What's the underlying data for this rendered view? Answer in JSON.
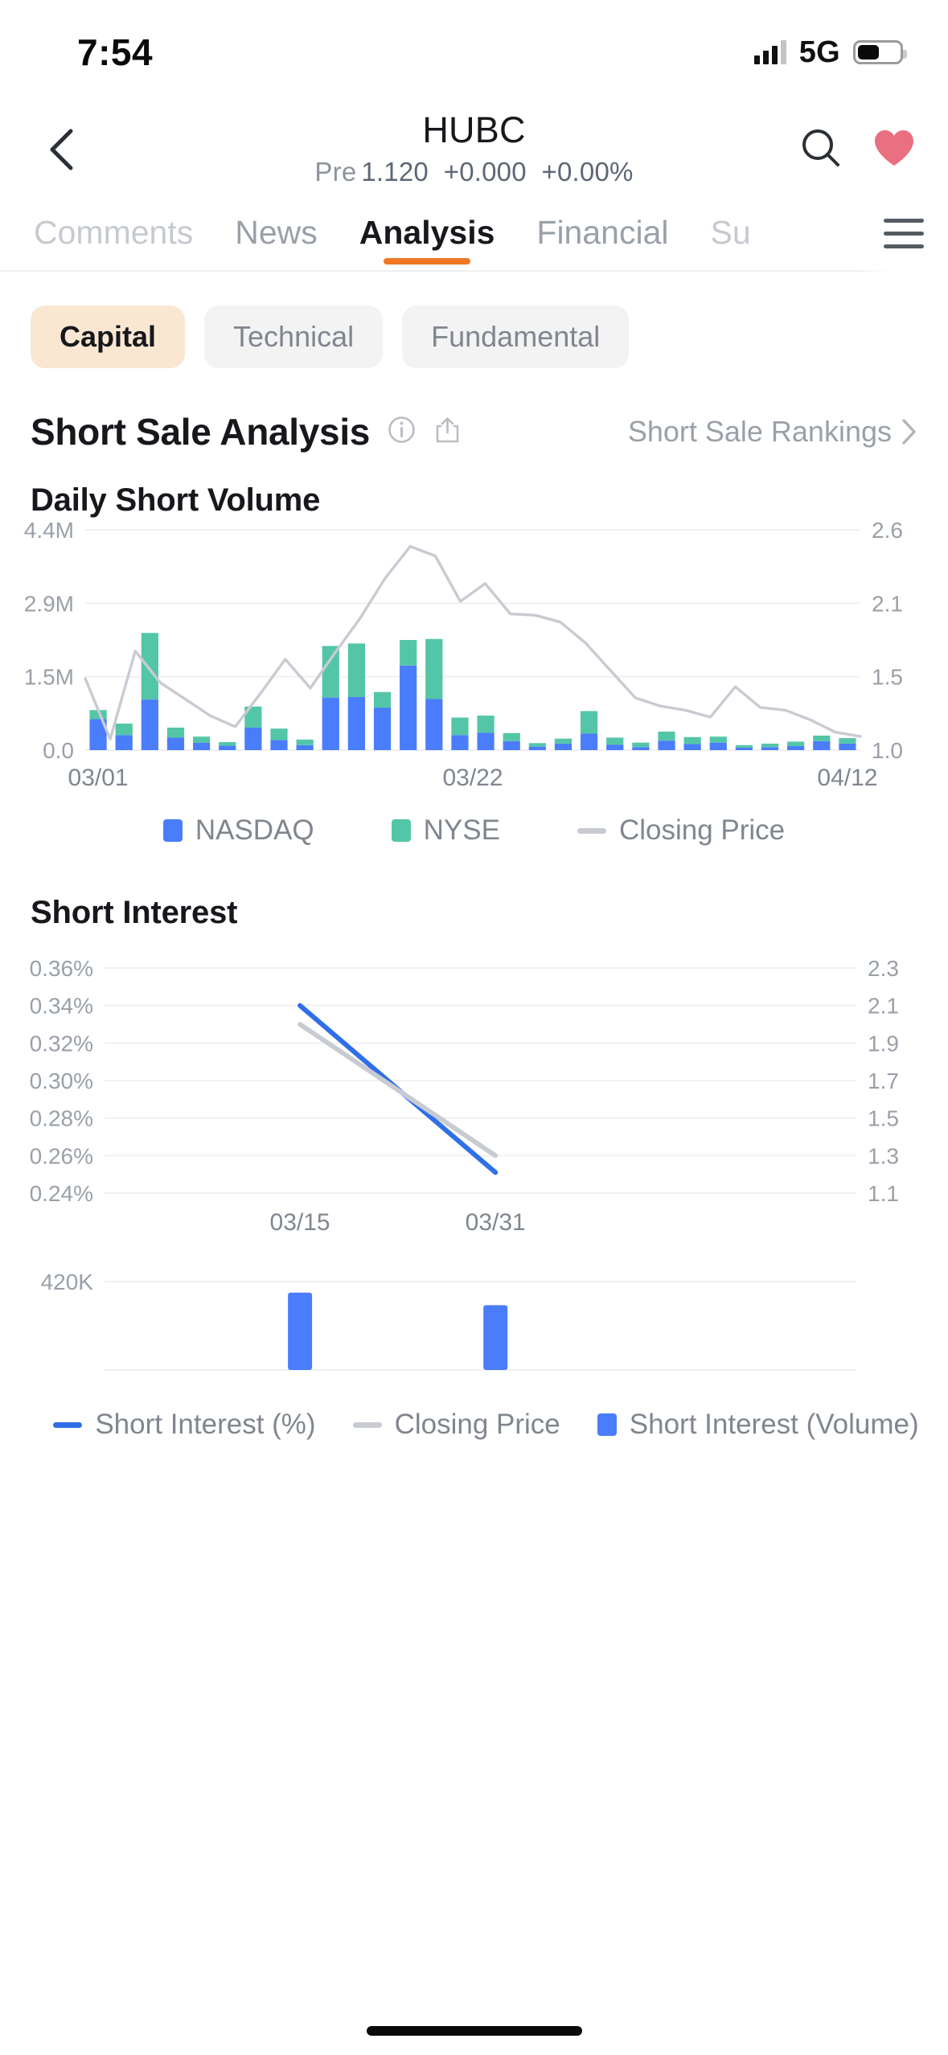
{
  "status_bar": {
    "time": "7:54",
    "network": "5G",
    "signal_icon": "cellular-signal-icon",
    "battery_icon": "battery-icon",
    "battery_level_pct": 52
  },
  "nav": {
    "back_icon": "chevron-left-icon",
    "title": "HUBC",
    "session_label": "Pre",
    "price": "1.120",
    "change": "+0.000",
    "change_pct": "+0.00%",
    "search_icon": "search-icon",
    "favorite_icon": "heart-icon",
    "favorite_color": "#ea6f80"
  },
  "tabs": {
    "items": [
      {
        "label": "Comments",
        "active": false,
        "faded": true
      },
      {
        "label": "News",
        "active": false,
        "faded": false
      },
      {
        "label": "Analysis",
        "active": true,
        "faded": false
      },
      {
        "label": "Financial",
        "active": false,
        "faded": false
      },
      {
        "label": "Su",
        "active": false,
        "faded": true
      }
    ],
    "active_indicator_color": "#ef7723",
    "menu_icon": "hamburger-menu-icon"
  },
  "chips": {
    "items": [
      {
        "label": "Capital",
        "active": true
      },
      {
        "label": "Technical",
        "active": false
      },
      {
        "label": "Fundamental",
        "active": false
      }
    ],
    "active_bg": "#fae7d2"
  },
  "section": {
    "title": "Short Sale Analysis",
    "info_icon": "info-circle-icon",
    "share_icon": "share-icon",
    "link_label": "Short Sale Rankings",
    "link_icon": "chevron-right-icon"
  },
  "chart_data": [
    {
      "type": "bar",
      "title": "Daily Short Volume",
      "stacked": true,
      "xlabel": "",
      "ylabel": "",
      "ylim": [
        0,
        4400000
      ],
      "y_ticks": [
        "0.0",
        "1.5M",
        "2.9M",
        "4.4M"
      ],
      "y2lim": [
        1.0,
        2.6
      ],
      "y2_ticks": [
        "1.0",
        "1.5",
        "2.1",
        "2.6"
      ],
      "x_ticks": [
        "03/01",
        "03/22",
        "04/12"
      ],
      "grid": true,
      "legend_position": "bottom",
      "legend": [
        {
          "name": "NASDAQ",
          "color": "#4a7dfc",
          "marker": "square"
        },
        {
          "name": "NYSE",
          "color": "#54c6a8",
          "marker": "square"
        },
        {
          "name": "Closing Price",
          "color": "#c8cbd2",
          "marker": "line"
        }
      ],
      "series": [
        {
          "name": "NASDAQ",
          "color": "#4a7dfc",
          "values": [
            620000,
            300000,
            1010000,
            250000,
            150000,
            90000,
            450000,
            200000,
            100000,
            1050000,
            1060000,
            850000,
            1690000,
            1020000,
            300000,
            350000,
            180000,
            70000,
            130000,
            330000,
            110000,
            60000,
            190000,
            120000,
            150000,
            50000,
            60000,
            80000,
            180000,
            130000
          ]
        },
        {
          "name": "NYSE",
          "color": "#54c6a8",
          "values": [
            180000,
            230000,
            1330000,
            200000,
            120000,
            70000,
            420000,
            230000,
            110000,
            1030000,
            1070000,
            310000,
            510000,
            1200000,
            350000,
            340000,
            160000,
            70000,
            100000,
            450000,
            140000,
            90000,
            180000,
            140000,
            120000,
            50000,
            70000,
            90000,
            110000,
            110000
          ]
        }
      ],
      "line_series": {
        "name": "Closing Price",
        "color": "#c8cbd2",
        "values": [
          1.52,
          1.08,
          1.72,
          1.49,
          1.37,
          1.25,
          1.17,
          1.41,
          1.66,
          1.45,
          1.71,
          1.96,
          2.25,
          2.48,
          2.41,
          2.08,
          2.21,
          1.99,
          1.98,
          1.93,
          1.78,
          1.58,
          1.38,
          1.32,
          1.29,
          1.24,
          1.46,
          1.31,
          1.29,
          1.22,
          1.13,
          1.1
        ]
      }
    },
    {
      "type": "line",
      "title": "Short Interest",
      "ylim": [
        0.24,
        0.36
      ],
      "y_ticks": [
        "0.24%",
        "0.26%",
        "0.28%",
        "0.30%",
        "0.32%",
        "0.34%",
        "0.36%"
      ],
      "y2lim": [
        1.1,
        2.3
      ],
      "y2_ticks": [
        "1.1",
        "1.3",
        "1.5",
        "1.7",
        "1.9",
        "2.1",
        "2.3"
      ],
      "x_ticks": [
        "03/15",
        "03/31"
      ],
      "grid": true,
      "legend_position": "bottom",
      "legend": [
        {
          "name": "Short Interest (%)",
          "color": "#2f6fe8",
          "marker": "line"
        },
        {
          "name": "Closing Price",
          "color": "#c8cbd2",
          "marker": "line"
        },
        {
          "name": "Short Interest (Volume)",
          "color": "#4a7dfc",
          "marker": "square"
        }
      ],
      "series": [
        {
          "name": "Short Interest (%)",
          "color": "#2f6fe8",
          "x": [
            "03/15",
            "03/31"
          ],
          "values": [
            0.34,
            0.251
          ]
        },
        {
          "name": "Closing Price",
          "color": "#c8cbd2",
          "x": [
            "03/15",
            "03/31"
          ],
          "values": [
            2.0,
            1.3
          ]
        }
      ],
      "volume_bars": {
        "name": "Short Interest (Volume)",
        "color": "#4a7dfc",
        "y_ticks": [
          "420K"
        ],
        "x": [
          "03/15",
          "03/31"
        ],
        "values": [
          420000,
          352000
        ]
      }
    }
  ]
}
